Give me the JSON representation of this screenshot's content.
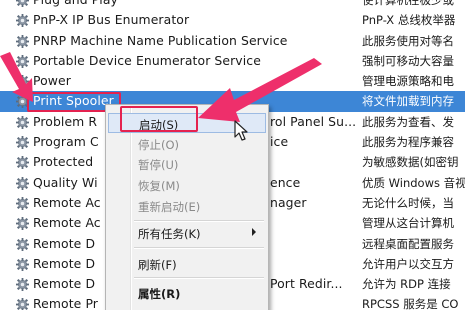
{
  "services": [
    {
      "name": "Plug and Play",
      "desc": "使计算机在极少或"
    },
    {
      "name": "PnP-X IP Bus Enumerator",
      "desc": "PnP-X 总线枚举器"
    },
    {
      "name": "PNRP Machine Name Publication Service",
      "desc": "此服务使用对等名"
    },
    {
      "name": "Portable Device Enumerator Service",
      "desc": "强制可移动大容量"
    },
    {
      "name": "Power",
      "desc": "管理电源策略和电"
    },
    {
      "name": "Print Spooler",
      "desc": "将文件加载到内存"
    },
    {
      "name": "Problem R",
      "desc": "此服务为查看、发",
      "tail": "rol Panel Su..."
    },
    {
      "name": "Program C",
      "desc": "此服务为程序兼容",
      "tail": "ice"
    },
    {
      "name": "Protected",
      "desc": "为敏感数据(如密钥"
    },
    {
      "name": "Quality Wi",
      "desc": "优质 Windows 音视",
      "tail": "ence"
    },
    {
      "name": "Remote Ac",
      "desc": "无论什么时候，当",
      "tail": "nager"
    },
    {
      "name": "Remote Ac",
      "desc": "管理从这台计算机"
    },
    {
      "name": "Remote D",
      "desc": "远程桌面配置服务"
    },
    {
      "name": "Remote D",
      "desc": "允许用户以交互方"
    },
    {
      "name": "Remote D",
      "desc": "允许为 RDP 连接",
      "tail": "Port Redir..."
    },
    {
      "name": "Remote Pr",
      "desc": "RPCSS 服务是 CO"
    }
  ],
  "context_menu": {
    "start": "启动(S)",
    "stop": "停止(O)",
    "pause": "暂停(U)",
    "resume": "恢复(M)",
    "restart": "重新启动(E)",
    "all_tasks": "所有任务(K)",
    "refresh": "刷新(F)",
    "properties": "属性(R)"
  },
  "colors": {
    "selection": "#3d86d6",
    "annotation": "#e4224f",
    "arrow": "#ee2f6b"
  },
  "icons": {
    "service": "gear-icon",
    "submenu": "chevron-right-icon",
    "pointer": "mouse-cursor-icon"
  }
}
